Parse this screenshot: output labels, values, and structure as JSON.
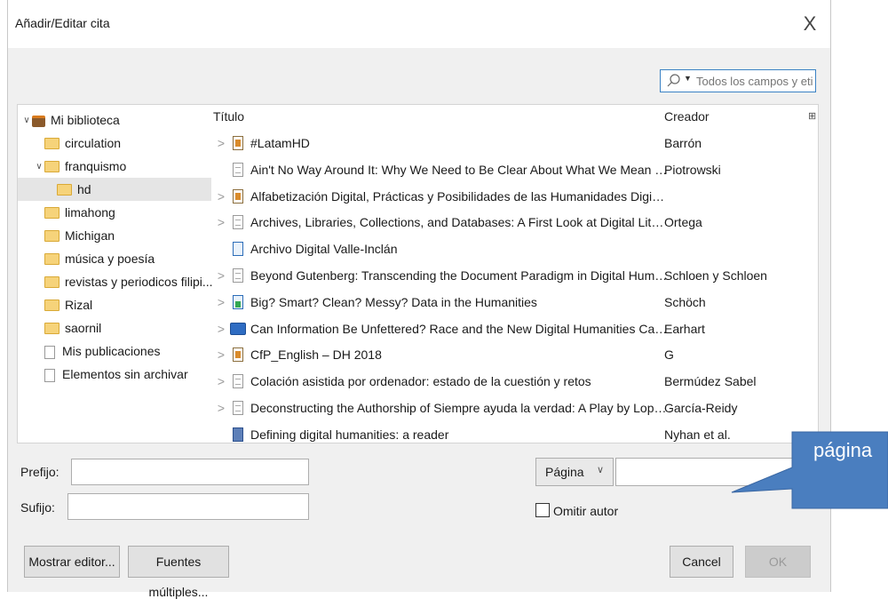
{
  "dialog": {
    "title": "Añadir/Editar cita",
    "close_glyph": "X"
  },
  "search": {
    "placeholder": "Todos los campos y etiq",
    "icon": "search-icon",
    "dropdown_glyph": "▼"
  },
  "collections": [
    {
      "label": "Mi biblioteca",
      "icon": "library-icon",
      "twisty": "∨",
      "level": 0,
      "selected": false
    },
    {
      "label": "circulation",
      "icon": "folder-icon",
      "twisty": "",
      "level": 1,
      "selected": false
    },
    {
      "label": "franquismo",
      "icon": "folder-icon",
      "twisty": "∨",
      "level": 1,
      "selected": false
    },
    {
      "label": "hd",
      "icon": "folder-icon",
      "twisty": "",
      "level": 2,
      "selected": true
    },
    {
      "label": "limahong",
      "icon": "folder-icon",
      "twisty": "",
      "level": 1,
      "selected": false
    },
    {
      "label": "Michigan",
      "icon": "folder-icon",
      "twisty": "",
      "level": 1,
      "selected": false
    },
    {
      "label": "música y poesía",
      "icon": "folder-icon",
      "twisty": "",
      "level": 1,
      "selected": false
    },
    {
      "label": "revistas y periodicos filipi...",
      "icon": "folder-icon",
      "twisty": "",
      "level": 1,
      "selected": false
    },
    {
      "label": "Rizal",
      "icon": "folder-icon",
      "twisty": "",
      "level": 1,
      "selected": false
    },
    {
      "label": "saornil",
      "icon": "folder-icon",
      "twisty": "",
      "level": 1,
      "selected": false
    },
    {
      "label": "Mis publicaciones",
      "icon": "document-icon",
      "twisty": "",
      "level": 1,
      "selected": false
    },
    {
      "label": "Elementos sin archivar",
      "icon": "documents-icon",
      "twisty": "",
      "level": 1,
      "selected": false
    }
  ],
  "items": {
    "headers": {
      "title": "Título",
      "creator": "Creador"
    },
    "column_picker_glyph": "⊞",
    "rows": [
      {
        "expander": ">",
        "icon": "presentation-icon",
        "title": "#LatamHD",
        "creator": "Barrón"
      },
      {
        "expander": "",
        "icon": "document-icon",
        "title": "Ain't No Way Around It: Why We Need to Be Clear About What We Mean by \"Digi...",
        "creator": "Piotrowski"
      },
      {
        "expander": ">",
        "icon": "presentation-icon",
        "title": "Alfabetización Digital, Prácticas y Posibilidades de las Humanidades Digitales en A...",
        "creator": ""
      },
      {
        "expander": ">",
        "icon": "document-icon",
        "title": "Archives, Libraries, Collections, and Databases: A First Look at Digital Literary Studi...",
        "creator": "Ortega"
      },
      {
        "expander": "",
        "icon": "webpage-icon",
        "title": "Archivo Digital Valle-Inclán",
        "creator": ""
      },
      {
        "expander": ">",
        "icon": "document-icon",
        "title": "Beyond Gutenberg: Transcending the Document Paradigm in Digital Humanities",
        "creator": "Schloen y Schloen"
      },
      {
        "expander": ">",
        "icon": "dataset-icon",
        "title": "Big? Smart? Clean? Messy? Data in the Humanities",
        "creator": "Schöch"
      },
      {
        "expander": ">",
        "icon": "book-open-icon",
        "title": "Can Information Be Unfettered? Race and the New Digital Humanities Canon",
        "creator": "Earhart"
      },
      {
        "expander": ">",
        "icon": "presentation-icon",
        "title": "CfP_English – DH 2018",
        "creator": "G"
      },
      {
        "expander": ">",
        "icon": "document-icon",
        "title": "Colación asistida por ordenador: estado de la cuestión y retos",
        "creator": "Bermúdez Sabel"
      },
      {
        "expander": ">",
        "icon": "document-icon",
        "title": "Deconstructing the Authorship of Siempre ayuda la verdad: A Play by Lope de Veg...",
        "creator": "García-Reidy"
      },
      {
        "expander": "",
        "icon": "book-icon",
        "title": "Defining digital humanities: a reader",
        "creator": "Nyhan et al."
      }
    ]
  },
  "citation": {
    "prefix_label": "Prefijo:",
    "prefix_value": "",
    "suffix_label": "Sufijo:",
    "suffix_value": "",
    "locator_type": "Página",
    "locator_chevron": "∨",
    "locator_value": "",
    "omit_author_label": "Omitir autor",
    "omit_author_checked": false
  },
  "buttons": {
    "show_editor": "Mostrar editor...",
    "multiple_sources": "Fuentes múltiples...",
    "cancel": "Cancel",
    "ok": "OK"
  },
  "callout": {
    "text": "página",
    "color": "#4a7ebf"
  }
}
